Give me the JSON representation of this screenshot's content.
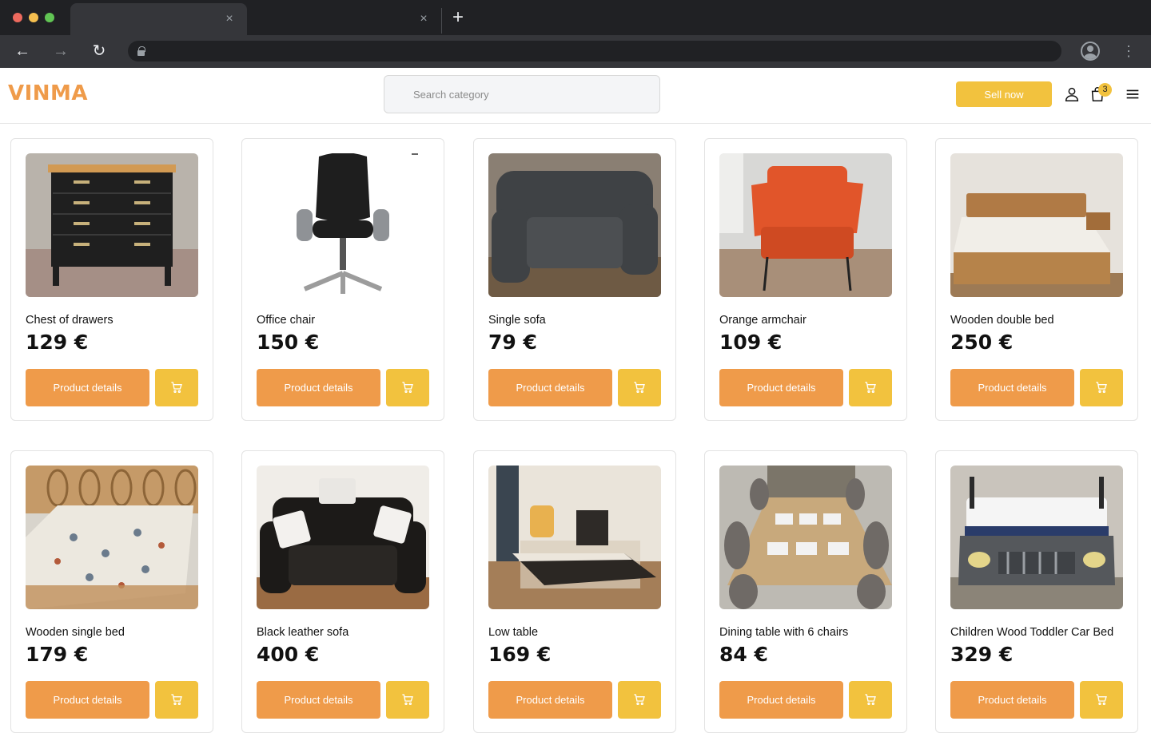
{
  "browser": {
    "tabs": [
      {
        "label": "",
        "close": "×"
      },
      {
        "label": "",
        "close": "×"
      }
    ],
    "new_tab": "+",
    "nav": {
      "back": "←",
      "forward": "→",
      "reload": "↻",
      "menu": "⋮"
    },
    "address": ""
  },
  "header": {
    "logo": "VINMA",
    "search": {
      "placeholder": "Search category"
    },
    "sell_label": "Sell now",
    "cart_count": "3",
    "icons": {
      "account": "user-icon",
      "cart": "shopping-bag-icon",
      "menu": "hamburger-menu-icon"
    }
  },
  "products": [
    {
      "name": "Chest of drawers",
      "price": "129 €",
      "details_label": "Product details",
      "image": "chest-of-drawers-photo",
      "colors": [
        "#b9b3ab",
        "#1f1f1f",
        "#d29a53"
      ]
    },
    {
      "name": "Office chair",
      "price": "150 €",
      "details_label": "Product details",
      "image": "office-chair-photo",
      "colors": [
        "#ffffff",
        "#1e1e1e",
        "#8f9296"
      ]
    },
    {
      "name": "Single sofa",
      "price": "79 €",
      "details_label": "Product details",
      "image": "single-sofa-photo",
      "colors": [
        "#8a7f73",
        "#3f4245",
        "#6e5a44"
      ]
    },
    {
      "name": "Orange armchair",
      "price": "109 €",
      "details_label": "Product details",
      "image": "orange-armchair-photo",
      "colors": [
        "#d8d8d6",
        "#e1552a",
        "#a88f79"
      ]
    },
    {
      "name": "Wooden double bed",
      "price": "250 €",
      "details_label": "Product details",
      "image": "wooden-double-bed-photo",
      "colors": [
        "#e6e2dc",
        "#f1eee8",
        "#b6834a"
      ]
    },
    {
      "name": "Wooden single bed",
      "price": "179 €",
      "details_label": "Product details",
      "image": "wooden-single-bed-photo",
      "colors": [
        "#d8d4cc",
        "#ece8df",
        "#c08e5a"
      ]
    },
    {
      "name": "Black leather sofa",
      "price": "400 €",
      "details_label": "Product details",
      "image": "black-leather-sofa-photo",
      "colors": [
        "#f0ede8",
        "#1c1a18",
        "#9a6b43"
      ]
    },
    {
      "name": "Low table",
      "price": "169 €",
      "details_label": "Product details",
      "image": "low-table-photo",
      "colors": [
        "#eae4da",
        "#2b2723",
        "#c9b08a"
      ]
    },
    {
      "name": "Dining table with 6 chairs",
      "price": "84 €",
      "details_label": "Product details",
      "image": "dining-table-photo",
      "colors": [
        "#bdbab3",
        "#c8a97c",
        "#6f6a66"
      ]
    },
    {
      "name": "Children Wood Toddler Car Bed",
      "price": "329 €",
      "details_label": "Product details",
      "image": "toddler-car-bed-photo",
      "colors": [
        "#c9c4bc",
        "#f5f5f5",
        "#55585c"
      ]
    }
  ],
  "colors": {
    "accent_orange": "#ef9b4a",
    "accent_yellow": "#f2c23e"
  }
}
